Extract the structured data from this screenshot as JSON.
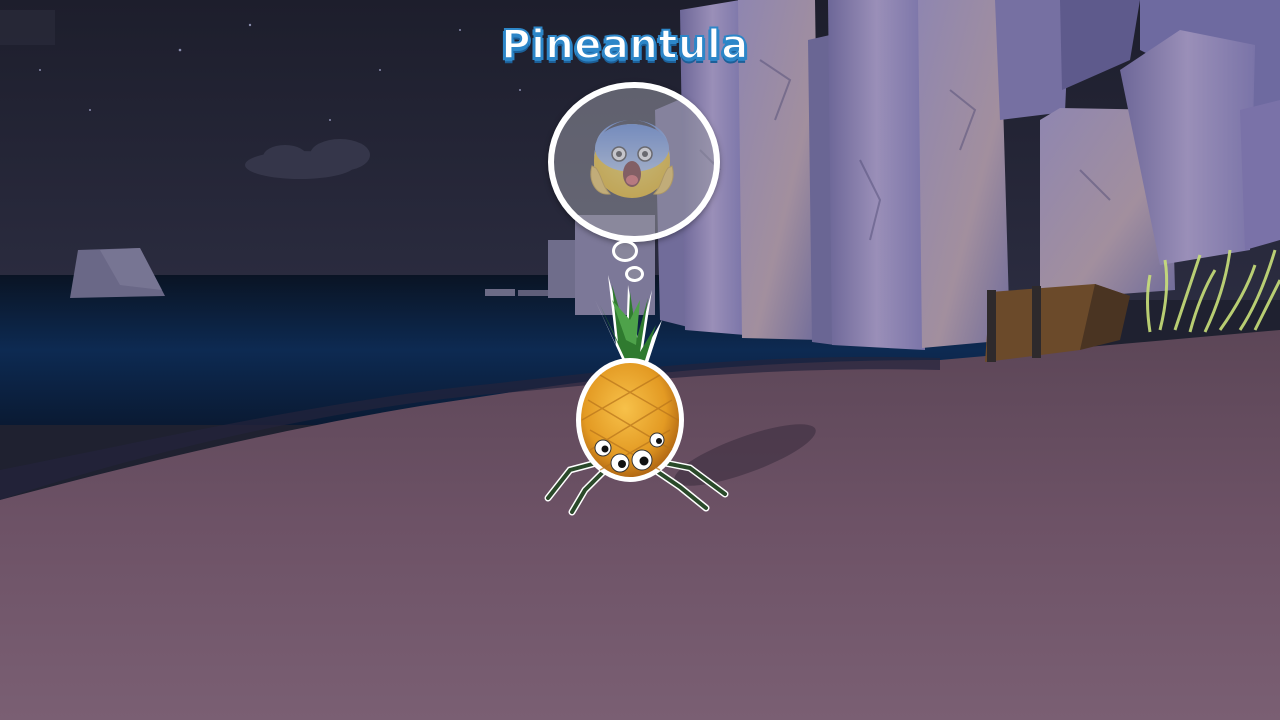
{
  "creature": {
    "name": "Pineantula",
    "emotion_icon": "scared-emoji-icon"
  },
  "colors": {
    "name_text": "#ffffff",
    "name_outline": "#2d86c8",
    "bubble_border": "#ffffff",
    "sky": "#23253a",
    "sea": "#0f2748",
    "sand": "#75596c",
    "rock": "#8a86b8"
  }
}
